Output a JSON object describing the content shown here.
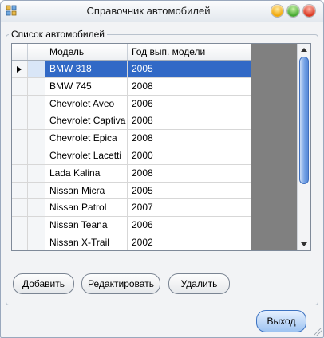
{
  "window": {
    "title": "Справочник автомобилей"
  },
  "group": {
    "label": "Список автомобилей"
  },
  "grid": {
    "columns": [
      "Модель",
      "Год вып. модели"
    ],
    "selected_row": 0,
    "rows": [
      {
        "model": "BMW 318",
        "year": "2005"
      },
      {
        "model": "BMW 745",
        "year": "2008"
      },
      {
        "model": "Chevrolet Aveo",
        "year": "2006"
      },
      {
        "model": "Chevrolet Captiva",
        "year": "2008"
      },
      {
        "model": "Chevrolet Epica",
        "year": "2008"
      },
      {
        "model": "Chevrolet Lacetti",
        "year": "2000"
      },
      {
        "model": "Lada Kalina",
        "year": "2008"
      },
      {
        "model": "Nissan Micra",
        "year": "2005"
      },
      {
        "model": "Nissan Patrol",
        "year": "2007"
      },
      {
        "model": "Nissan Teana",
        "year": "2006"
      },
      {
        "model": "Nissan X-Trail",
        "year": "2002"
      }
    ]
  },
  "buttons": {
    "add": "Добавить",
    "edit": "Редактировать",
    "delete": "Удалить",
    "exit": "Выход"
  },
  "icons": {
    "app": "app-grid-icon",
    "minimize": "minimize-icon",
    "maximize": "maximize-icon",
    "close": "close-icon"
  },
  "colors": {
    "selection": "#3169c6",
    "grid_background": "#808080"
  }
}
